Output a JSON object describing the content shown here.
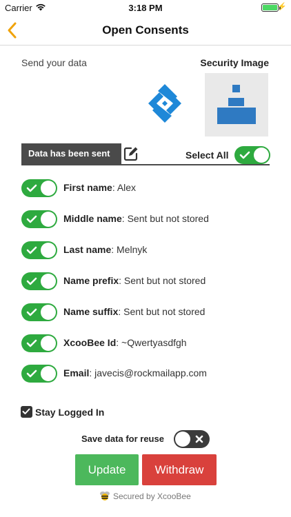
{
  "status_bar": {
    "carrier": "Carrier",
    "time": "3:18 PM",
    "battery_level": 1.0
  },
  "nav": {
    "title": "Open Consents"
  },
  "send_your_data": "Send your data",
  "security_image_label": "Security Image",
  "data_sent_label": "Data has been sent",
  "select_all": {
    "label": "Select All",
    "on": true
  },
  "fields": [
    {
      "label": "First name",
      "value": ": Alex",
      "on": true
    },
    {
      "label": "Middle name",
      "value": ": Sent but not stored",
      "on": true
    },
    {
      "label": "Last name",
      "value": ": Melnyk",
      "on": true
    },
    {
      "label": "Name prefix",
      "value": ": Sent but not stored",
      "on": true
    },
    {
      "label": "Name suffix",
      "value": ": Sent but not stored",
      "on": true
    },
    {
      "label": "XcooBee Id",
      "value": ": ~Qwertyasdfgh",
      "on": true
    },
    {
      "label": "Email",
      "value": ": javecis@rockmailapp.com",
      "on": true
    }
  ],
  "stay_logged_in": {
    "label": "Stay Logged In",
    "checked": true
  },
  "save_for_reuse": {
    "label": "Save data for reuse",
    "on": false
  },
  "buttons": {
    "update": "Update",
    "withdraw": "Withdraw"
  },
  "footer": {
    "secured_by": "Secured by XcooBee"
  },
  "colors": {
    "accent_back": "#f0a30a",
    "toggle_on": "#2eaa3f",
    "toggle_off": "#3b3b3b",
    "update_button": "#4cb85c",
    "withdraw_button": "#d9413c",
    "logo_blue": "#1e88d8",
    "security_image_blue": "#2f7ac2"
  }
}
